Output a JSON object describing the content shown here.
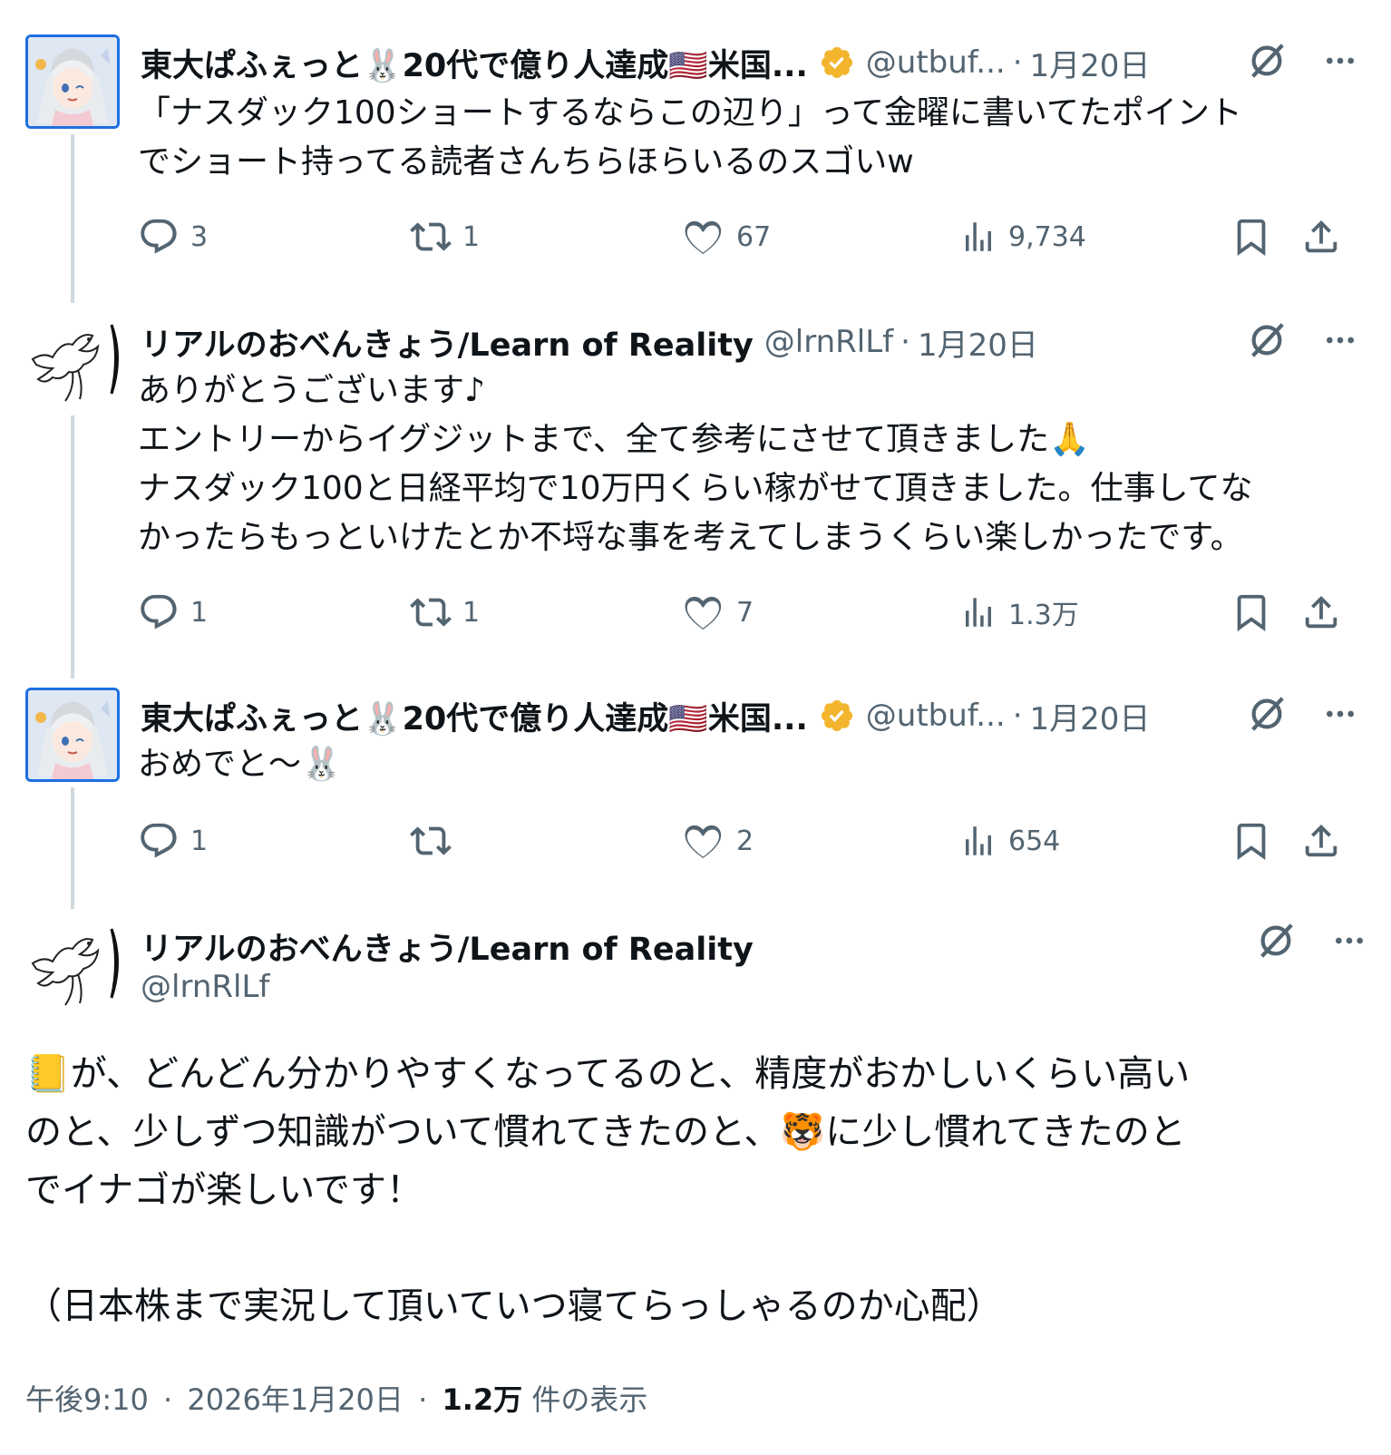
{
  "accent": "#1d9bf0",
  "verified_color": "#f3b52e",
  "tweets": [
    {
      "name": "東大ぱふぇっと🐰20代で億り人達成🇺🇸米国...",
      "handle": "@utbuf...",
      "sep": "·",
      "time": "1月20日",
      "verified": true,
      "avatar": "anime-girl-avatar",
      "text_lines": [
        "「ナスダック100ショートするならこの辺り」って金曜に書いてたポイント",
        "でショート持ってる読者さんちらほらいるのスゴいw"
      ],
      "replies": "3",
      "retweets": "1",
      "likes": "67",
      "views": "9,734"
    },
    {
      "name": "リアルのおべんきょう/Learn of Reality",
      "handle": "@lrnRlLf",
      "sep": "·",
      "time": "1月20日",
      "verified": false,
      "avatar": "bird-sketch-avatar",
      "text_lines": [
        "ありがとうございます♪",
        "エントリーからイグジットまで、全て参考にさせて頂きました🙏",
        "ナスダック100と日経平均で10万円くらい稼がせて頂きました。仕事してな",
        "かったらもっといけたとか不埒な事を考えてしまうくらい楽しかったです。"
      ],
      "replies": "1",
      "retweets": "1",
      "likes": "7",
      "views": "1.3万"
    },
    {
      "name": "東大ぱふぇっと🐰20代で億り人達成🇺🇸米国...",
      "handle": "@utbuf...",
      "sep": "·",
      "time": "1月20日",
      "verified": true,
      "avatar": "anime-girl-avatar",
      "text_lines": [
        "おめでと〜🐰"
      ],
      "replies": "1",
      "retweets": "",
      "likes": "2",
      "views": "654"
    }
  ],
  "focus": {
    "name": "リアルのおべんきょう/Learn of Reality",
    "handle": "@lrnRlLf",
    "text_lines": [
      "📒が、どんどん分かりやすくなってるのと、精度がおかしいくらい高い",
      "のと、少しずつ知識がついて慣れてきたのと、🐯に少し慣れてきたのと",
      "でイナゴが楽しいです！",
      "",
      "（日本株まで実況して頂いていつ寝てらっしゃるのか心配）"
    ],
    "time": "午後9:10",
    "sep": "·",
    "date": "2026年1月20日",
    "views_count": "1.2万",
    "views_label": "件の表示"
  },
  "icons": {
    "grok": "grok-icon",
    "more": "more-icon",
    "reply": "reply-icon",
    "retweet": "retweet-icon",
    "like": "like-icon",
    "views": "views-icon",
    "bookmark": "bookmark-icon",
    "share": "share-icon",
    "verified": "verified-badge-icon"
  }
}
